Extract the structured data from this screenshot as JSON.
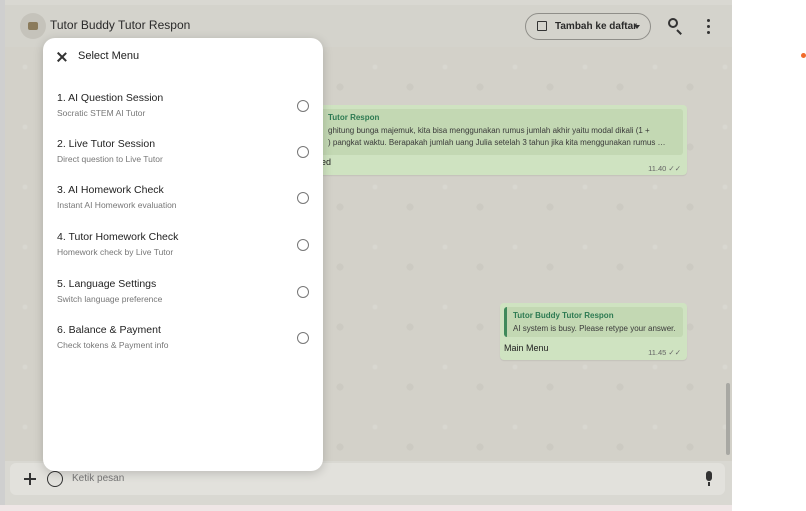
{
  "header": {
    "title": "Tutor Buddy Tutor Respon",
    "add_button_label": "Tambah ke daftar",
    "search_icon": "search-icon",
    "more_icon": "more-vertical-icon"
  },
  "messages": [
    {
      "quote_title": "Tutor Respon",
      "quote_body_line1": "ghitung bunga majemuk, kita bisa menggunakan rumus jumlah akhir yaitu modal dikali (1 +",
      "quote_body_line2": ") pangkat waktu. Berapakah jumlah uang Julia setelah 3 tahun jika kita menggunakan rumus …",
      "text": "ed",
      "time": "11.40",
      "ticks": "✓✓"
    },
    {
      "quote_title": "Tutor Buddy Tutor Respon",
      "quote_body_line1": "AI system is busy. Please retype your answer.",
      "text": "Main Menu",
      "time": "11.45",
      "ticks": "✓✓"
    }
  ],
  "composer": {
    "placeholder": "Ketik pesan"
  },
  "modal": {
    "title": "Select Menu",
    "items": [
      {
        "label": "1. AI Question Session",
        "sublabel": "Socratic STEM AI Tutor"
      },
      {
        "label": "2. Live Tutor Session",
        "sublabel": "Direct question to Live Tutor"
      },
      {
        "label": "3. AI Homework Check",
        "sublabel": "Instant AI Homework evaluation"
      },
      {
        "label": "4. Tutor Homework Check",
        "sublabel": "Homework check by Live Tutor"
      },
      {
        "label": "5. Language Settings",
        "sublabel": "Switch language preference"
      },
      {
        "label": "6. Balance & Payment",
        "sublabel": "Check tokens & Payment info"
      }
    ]
  },
  "colors": {
    "bubble": "#cfe3c1",
    "accent": "#2d7a52"
  }
}
